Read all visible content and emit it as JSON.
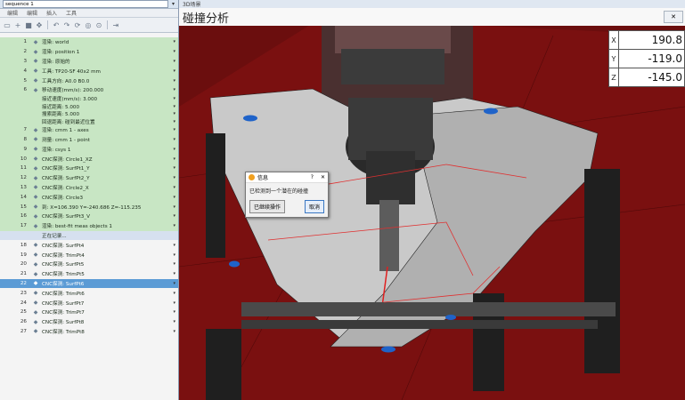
{
  "left_panel": {
    "sequence_value": "sequence 1",
    "menu": [
      "编辑",
      "编辑",
      "插入",
      "工具"
    ],
    "rows": [
      {
        "num": "1",
        "label": "渲染: world",
        "style": "g"
      },
      {
        "num": "2",
        "label": "渲染: position 1",
        "style": "g"
      },
      {
        "num": "3",
        "label": "渲染: 原始的",
        "style": "g"
      },
      {
        "num": "4",
        "label": "工具: TP20-SF 40x2 mm",
        "style": "g"
      },
      {
        "num": "5",
        "label": "工具方向: A0.0 B0.0",
        "style": "g"
      },
      {
        "num": "6",
        "label": "移动速度(mm/s): 200.000",
        "style": "g"
      },
      {
        "num": "",
        "label": "接近速度(mm/s): 3.000",
        "style": "g sub"
      },
      {
        "num": "",
        "label": "接近距离: 5.000",
        "style": "g sub"
      },
      {
        "num": "",
        "label": "搜索距离: 5.000",
        "style": "g sub"
      },
      {
        "num": "",
        "label": "回退距离: 碰到最近位置",
        "style": "g sub"
      },
      {
        "num": "7",
        "label": "渲染: cmm 1 - axes",
        "style": "g"
      },
      {
        "num": "8",
        "label": "测量: cmm 1 - point",
        "style": "g"
      },
      {
        "num": "9",
        "label": "渲染: csys 1",
        "style": "g"
      },
      {
        "num": "10",
        "label": "CNC探测: Circle1_XZ",
        "style": "g"
      },
      {
        "num": "11",
        "label": "CNC探测: SurfPt1_Y",
        "style": "g"
      },
      {
        "num": "12",
        "label": "CNC探测: SurfPt2_Y",
        "style": "g"
      },
      {
        "num": "13",
        "label": "CNC探测: Circle2_X",
        "style": "g"
      },
      {
        "num": "14",
        "label": "CNC探测: Circle3",
        "style": "g"
      },
      {
        "num": "15",
        "label": "到: X=106.390 Y=-240.686 Z=-115.235",
        "style": "g"
      },
      {
        "num": "16",
        "label": "CNC探测: SurfPt3_V",
        "style": "g"
      },
      {
        "num": "17",
        "label": "渲染: best-fit meas objects 1",
        "style": "g"
      },
      {
        "num": "",
        "label": "正在记录...",
        "style": "warn"
      },
      {
        "num": "18",
        "label": "CNC探测: SurfPt4",
        "style": ""
      },
      {
        "num": "19",
        "label": "CNC探测: TrimPt4",
        "style": ""
      },
      {
        "num": "20",
        "label": "CNC探测: SurfPt5",
        "style": ""
      },
      {
        "num": "21",
        "label": "CNC探测: TrimPt5",
        "style": ""
      },
      {
        "num": "22",
        "label": "CNC探测: SurfPt6",
        "style": "sel"
      },
      {
        "num": "23",
        "label": "CNC探测: TrimPt6",
        "style": ""
      },
      {
        "num": "24",
        "label": "CNC探测: SurfPt7",
        "style": ""
      },
      {
        "num": "25",
        "label": "CNC探测: TrimPt7",
        "style": ""
      },
      {
        "num": "26",
        "label": "CNC探测: SurfPt8",
        "style": ""
      },
      {
        "num": "27",
        "label": "CNC探测: TrimPt8",
        "style": ""
      }
    ]
  },
  "scene": {
    "tab_label": "3D场景",
    "title": "碰撞分析",
    "coords": [
      {
        "axis": "X",
        "value": "190.8"
      },
      {
        "axis": "Y",
        "value": "-119.0"
      },
      {
        "axis": "Z",
        "value": "-145.0"
      }
    ]
  },
  "dialog": {
    "title": "信息",
    "help": "?",
    "message": "已检测到一个潜在的碰撞",
    "continue_label": "已继续操作",
    "cancel_label": "取消"
  },
  "colors": {
    "background": "#6b0e0e",
    "accent": "#c8e6c4"
  }
}
